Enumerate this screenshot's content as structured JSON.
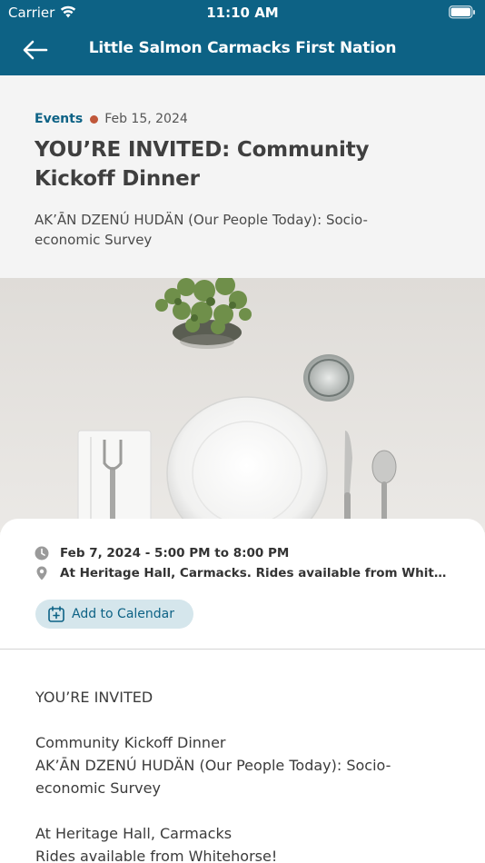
{
  "status_bar": {
    "carrier": "Carrier",
    "time": "11:10 AM"
  },
  "nav": {
    "title": "Little Salmon Carmacks First Nation",
    "back_icon": "arrow-left-icon"
  },
  "article": {
    "category": "Events",
    "published": "Feb 15, 2024",
    "title": "YOU’RE INVITED: Community Kickoff Dinner",
    "subtitle": "AK’ĀN DZENÚ HUDÄN (Our People Today): Socio-economic Survey"
  },
  "event": {
    "datetime": "Feb 7, 2024 - 5:00 PM to 8:00 PM",
    "location": "At Heritage Hall, Carmacks. Rides available from Whitehorse!",
    "calendar_label": "Add to Calendar"
  },
  "body": {
    "p1": "YOU’RE INVITED",
    "p2_line1": "Community Kickoff Dinner",
    "p2_line2": "AK’ĀN DZENÚ HUDÄN (Our People Today): Socio-economic Survey",
    "p3_line1": "At Heritage Hall, Carmacks",
    "p3_line2": "Rides available from Whitehorse!"
  },
  "colors": {
    "brand": "#0d6285",
    "accent_dot": "#c0573a",
    "button_bg": "#d5e6ec"
  }
}
